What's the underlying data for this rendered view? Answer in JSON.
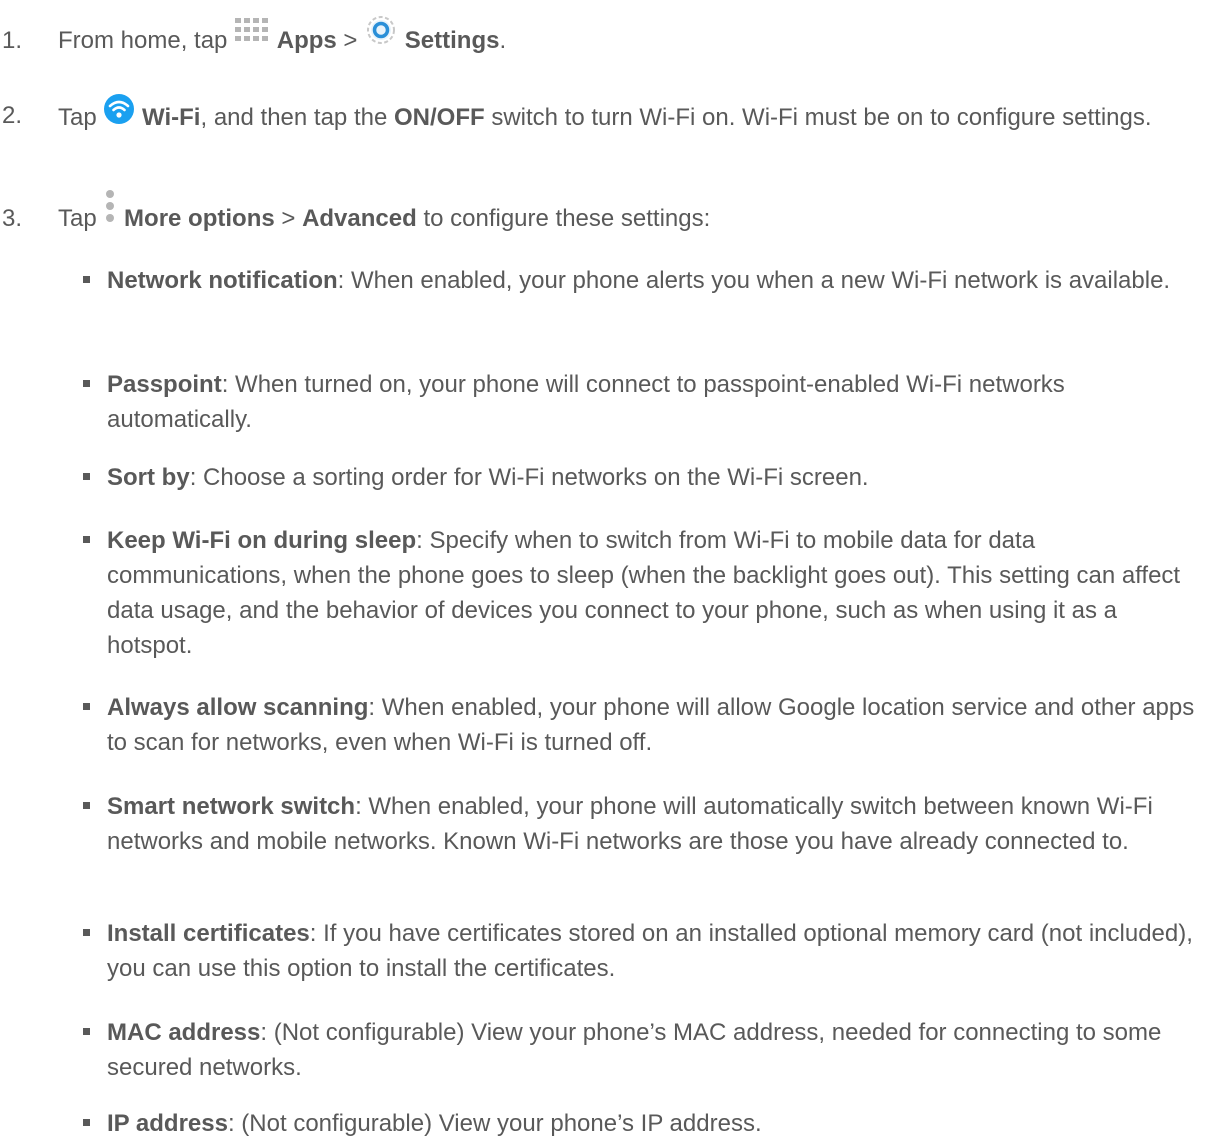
{
  "colors": {
    "text": "#595959",
    "wifi_blue": "#1aa0f0",
    "settings_blue": "#2a8fd8",
    "icon_grey": "#b5b5b5"
  },
  "steps": [
    {
      "num": "1.",
      "t1": "From home, tap",
      "icon1": "apps-grid-icon",
      "b1": "Apps",
      "sep": ">",
      "icon2": "settings-gear-icon",
      "b2": "Settings",
      "end": "."
    },
    {
      "num": "2.",
      "t1": "Tap",
      "icon1": "wifi-icon",
      "b1": "Wi-Fi",
      "t2": ", and then tap the",
      "b2": "ON/OFF",
      "t3": "switch to turn Wi-Fi on. Wi-Fi must be on to configure settings."
    },
    {
      "num": "3.",
      "t1": "Tap",
      "icon1": "more-options-icon",
      "b1": "More options",
      "sep": ">",
      "b2": "Advanced",
      "t2": "to configure these settings:"
    }
  ],
  "bullets": [
    {
      "term": "Network notification",
      "desc": ": When enabled, your phone alerts you when a new Wi-Fi network is available."
    },
    {
      "term": "Passpoint",
      "desc": ": When turned on, your phone will connect to passpoint-enabled Wi-Fi networks automatically."
    },
    {
      "term": "Sort by",
      "desc": ": Choose a sorting order for Wi-Fi networks on the Wi-Fi screen."
    },
    {
      "term": "Keep Wi-Fi on during sleep",
      "desc": ": Specify when to switch from Wi-Fi to mobile data for data communications, when the phone goes to sleep (when the backlight goes out). This setting can affect data usage, and the behavior of devices you connect to your phone, such as when using it as a hotspot."
    },
    {
      "term": "Always allow scanning",
      "desc": ": When enabled, your phone will allow Google location service and other apps to scan for networks, even when Wi-Fi is turned off."
    },
    {
      "term": "Smart network switch",
      "desc": ": When enabled, your phone will automatically switch between known Wi-Fi networks and mobile networks. Known Wi-Fi networks are those you have already connected to."
    },
    {
      "term": "Install certificates",
      "desc": ": If you have certificates stored on an installed optional memory card (not included), you can use this option to install the certificates."
    },
    {
      "term": "MAC address",
      "desc": ": (Not configurable) View your phone’s MAC address, needed for connecting to some secured networks."
    },
    {
      "term": "IP address",
      "desc": ": (Not configurable) View your phone’s IP address."
    }
  ]
}
